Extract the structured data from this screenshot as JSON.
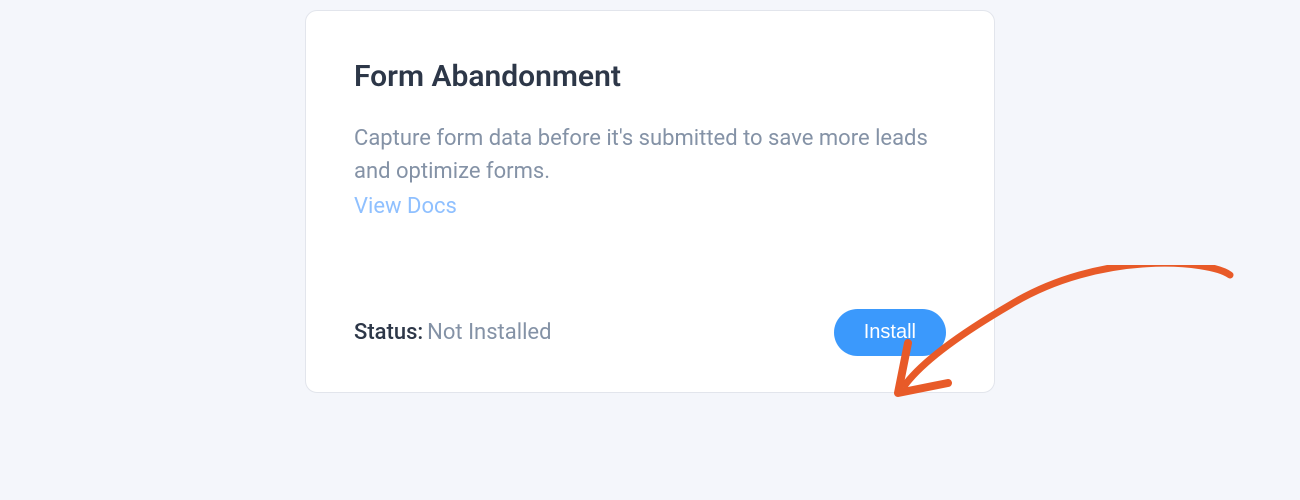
{
  "card": {
    "title": "Form Abandonment",
    "description": "Capture form data before it's submitted to save more leads and optimize forms.",
    "docs_link_label": "View Docs",
    "status_label": "Status:",
    "status_value": "Not Installed",
    "install_button_label": "Install"
  }
}
